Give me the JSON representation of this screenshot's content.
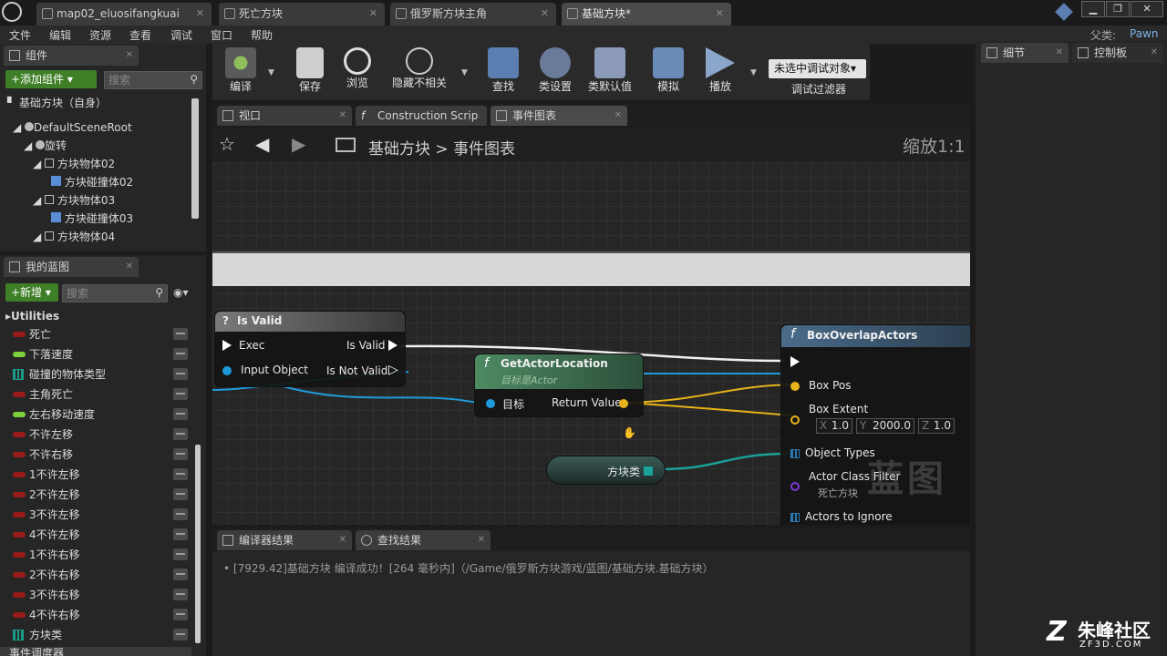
{
  "titlebar": {
    "tabs": [
      "map02_eluosifangkuai",
      "死亡方块",
      "俄罗斯方块主角",
      "基础方块*"
    ],
    "parent_label": "父类:",
    "parent_value": "Pawn"
  },
  "menu": [
    "文件",
    "编辑",
    "资源",
    "查看",
    "调试",
    "窗口",
    "帮助"
  ],
  "components": {
    "tab": "组件",
    "add_button": "+添加组件",
    "search_placeholder": "搜索",
    "self_label": "基础方块（自身）",
    "tree": [
      "DefaultSceneRoot",
      "旋转",
      "方块物体02",
      "方块碰撞体02",
      "方块物体03",
      "方块碰撞体03",
      "方块物体04"
    ]
  },
  "myblueprint": {
    "tab": "我的蓝图",
    "new_button": "+新增",
    "search_placeholder": "搜索",
    "category": "Utilities",
    "vars": [
      {
        "name": "死亡",
        "color": "#9a1a1a",
        "kind": "pill"
      },
      {
        "name": "下落速度",
        "color": "#7fd13b",
        "kind": "pill"
      },
      {
        "name": "碰撞的物体类型",
        "color": "#1a9c8a",
        "kind": "grid"
      },
      {
        "name": "主角死亡",
        "color": "#9a1a1a",
        "kind": "pill"
      },
      {
        "name": "左右移动速度",
        "color": "#7fd13b",
        "kind": "pill"
      },
      {
        "name": "不许左移",
        "color": "#9a1a1a",
        "kind": "pill"
      },
      {
        "name": "不许右移",
        "color": "#9a1a1a",
        "kind": "pill"
      },
      {
        "name": "1不许左移",
        "color": "#9a1a1a",
        "kind": "pill"
      },
      {
        "name": "2不许左移",
        "color": "#9a1a1a",
        "kind": "pill"
      },
      {
        "name": "3不许左移",
        "color": "#9a1a1a",
        "kind": "pill"
      },
      {
        "name": "4不许左移",
        "color": "#9a1a1a",
        "kind": "pill"
      },
      {
        "name": "1不许右移",
        "color": "#9a1a1a",
        "kind": "pill"
      },
      {
        "name": "2不许右移",
        "color": "#9a1a1a",
        "kind": "pill"
      },
      {
        "name": "3不许右移",
        "color": "#9a1a1a",
        "kind": "pill"
      },
      {
        "name": "4不许右移",
        "color": "#9a1a1a",
        "kind": "pill"
      },
      {
        "name": "方块类",
        "color": "#1a9c8a",
        "kind": "grid"
      }
    ],
    "footer": "事件调度器"
  },
  "toolbar": {
    "buttons": [
      "编译",
      "保存",
      "浏览",
      "隐藏不相关",
      "查找",
      "类设置",
      "类默认值",
      "模拟",
      "播放"
    ],
    "debug_select": "未选中调试对象",
    "debug_filter": "调试过滤器"
  },
  "editor_tabs": [
    "视口",
    "Construction Scrip",
    "事件图表"
  ],
  "breadcrumb": {
    "root": "基础方块",
    "sep": ">",
    "current": "事件图表",
    "zoom": "缩放1:1"
  },
  "nodes": {
    "isvalid": {
      "title": "Is Valid",
      "exec": "Exec",
      "input": "Input Object",
      "out_valid": "Is Valid",
      "out_not": "Is Not Valid"
    },
    "getloc": {
      "title": "GetActorLocation",
      "subtitle": "目标是Actor",
      "target": "目标",
      "ret": "Return Value"
    },
    "fkl": {
      "label": "方块类"
    },
    "box": {
      "title": "BoxOverlapActors",
      "pos": "Box Pos",
      "extent": "Box Extent",
      "x": "1.0",
      "y": "2000.0",
      "z": "1.0",
      "types": "Object Types",
      "filter": "Actor Class Filter",
      "filter_val": "死亡方块",
      "ignore": "Actors to Ignore"
    },
    "watermark": "蓝图"
  },
  "bottom_tabs": [
    "编译器结果",
    "查找结果"
  ],
  "log": "[7929.42]基础方块 编译成功！[264 毫秒内]（/Game/俄罗斯方块游戏/蓝图/基础方块.基础方块）",
  "right_tabs": [
    "细节",
    "控制板"
  ],
  "brand": {
    "name": "朱峰社区",
    "url": "ZF3D.COM"
  }
}
